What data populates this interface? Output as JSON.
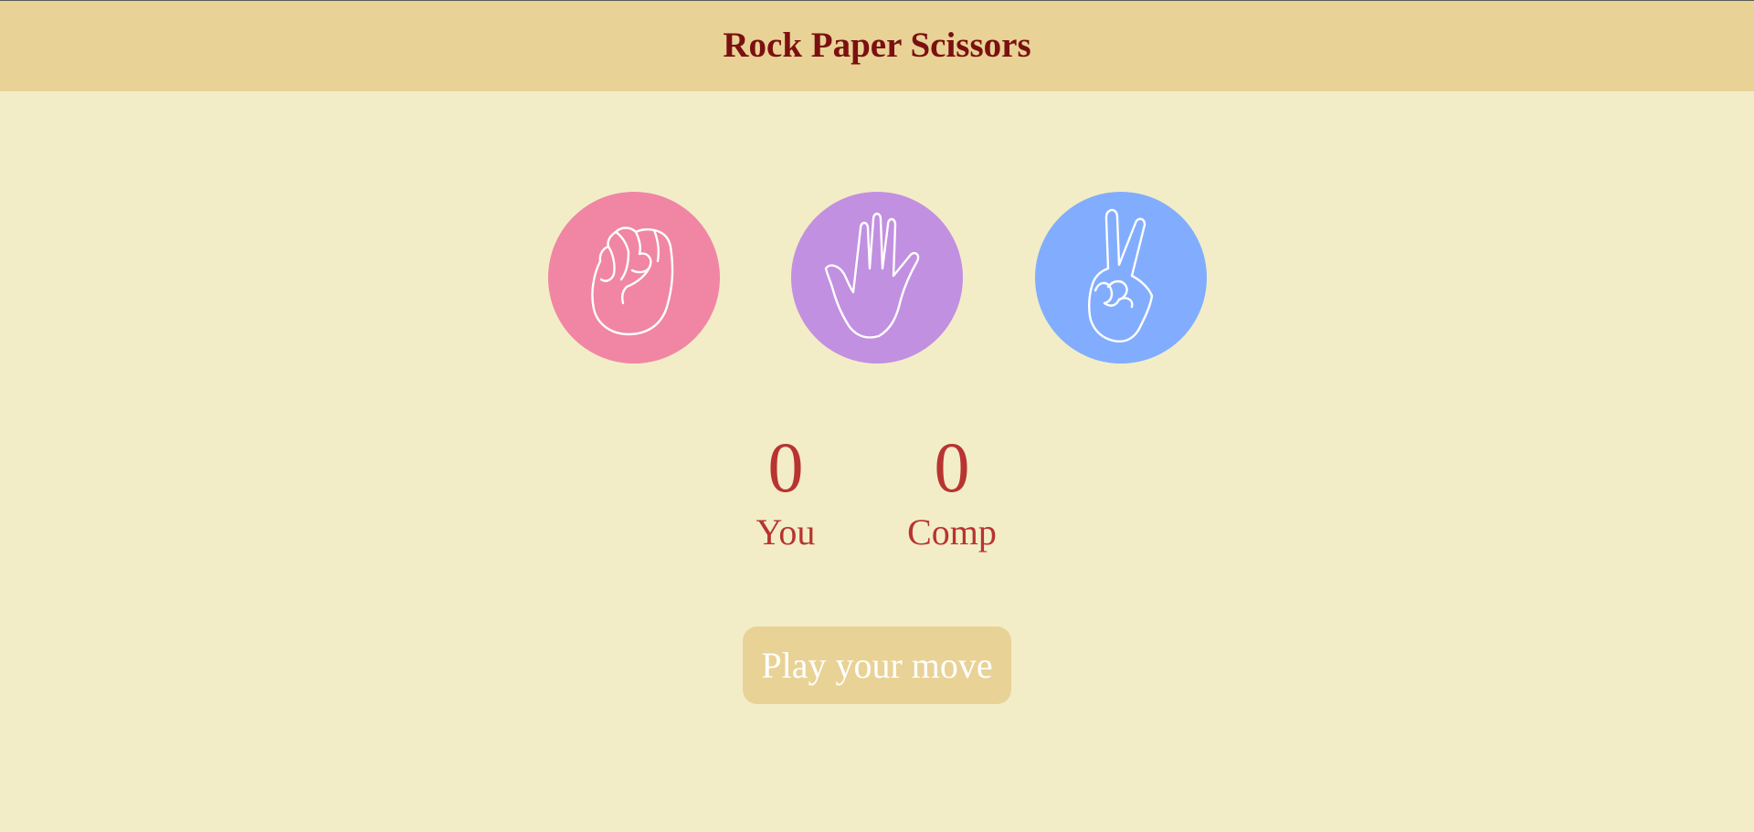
{
  "header": {
    "title": "Rock Paper Scissors"
  },
  "choices": [
    {
      "id": "rock",
      "icon": "fist-icon",
      "color": "#f086a4"
    },
    {
      "id": "paper",
      "icon": "open-hand-icon",
      "color": "#c290e0"
    },
    {
      "id": "scissors",
      "icon": "peace-hand-icon",
      "color": "#82adfe"
    }
  ],
  "scoreboard": {
    "user": {
      "score": "0",
      "label": "You"
    },
    "comp": {
      "score": "0",
      "label": "Comp"
    }
  },
  "message": {
    "text": "Play your move",
    "background": "#e9d296"
  },
  "colors": {
    "page_background": "#f3edc7",
    "header_background": "#e9d296",
    "title_color": "#7b1010",
    "score_color": "#b73431"
  }
}
